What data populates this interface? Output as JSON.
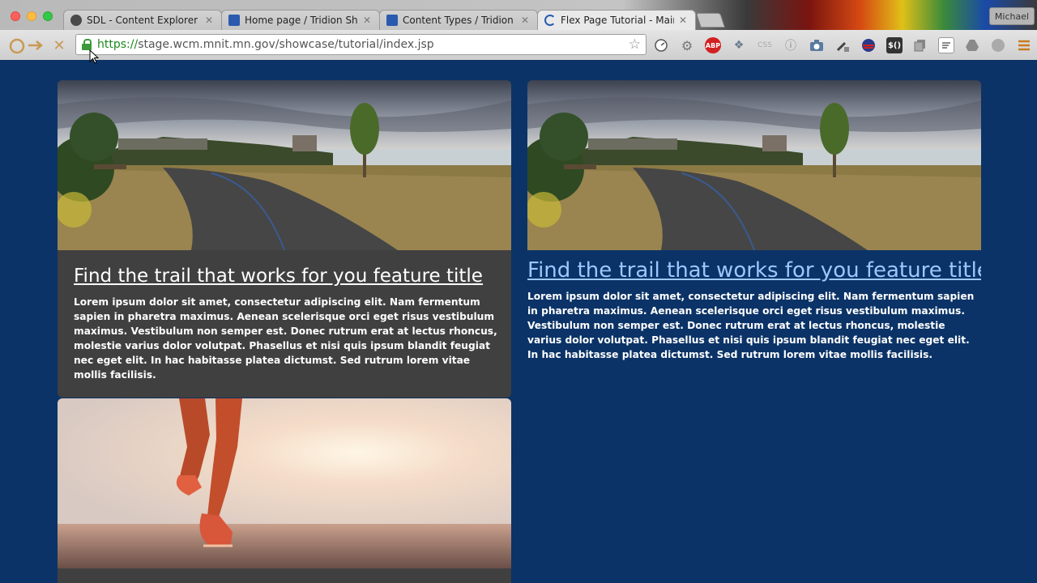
{
  "browser": {
    "tabs": [
      {
        "label": "SDL - Content Explorer",
        "favicon_color": "#4a4a4a",
        "active": false
      },
      {
        "label": "Home page / Tridion Showcase",
        "favicon_color": "#2a5ab0",
        "active": false
      },
      {
        "label": "Content Types / Tridion Showcase",
        "favicon_color": "#2a5ab0",
        "active": false
      },
      {
        "label": "Flex Page Tutorial - Main / Tridion",
        "favicon_color": "#2a5ab0",
        "active": true
      }
    ],
    "profile_name": "Michael",
    "url_scheme": "https://",
    "url_rest": "stage.wcm.mnit.mn.gov/showcase/tutorial/index.jsp",
    "extensions": [
      "ABP",
      "CSS",
      "$()"
    ]
  },
  "page": {
    "background": "#0b3367",
    "cards": [
      {
        "image": "lakeside-trail",
        "title": "Find the trail that works for you feature title",
        "body": "Lorem ipsum dolor sit amet, consectetur adipiscing elit. Nam fermentum sapien in pharetra maximus. Aenean scelerisque orci eget risus vestibulum maximus. Vestibulum non semper est. Donec rutrum erat at lectus rhoncus, molestie varius dolor volutpat. Phasellus et nisi quis ipsum blandit feugiat nec eget elit. In hac habitasse platea dictumst. Sed rutrum lorem vitae mollis facilisis.",
        "panel_color": "#404040",
        "title_color": "#ffffff"
      },
      {
        "image": "lakeside-trail",
        "title": "Find the trail that works for you feature title",
        "body": "Lorem ipsum dolor sit amet, consectetur adipiscing elit. Nam fermentum sapien in pharetra maximus. Aenean scelerisque orci eget risus vestibulum maximus. Vestibulum non semper est. Donec rutrum erat at lectus rhoncus, molestie varius dolor volutpat. Phasellus et nisi quis ipsum blandit feugiat nec eget elit. In hac habitasse platea dictumst. Sed rutrum lorem vitae mollis facilisis.",
        "panel_color": "#0b3367",
        "title_color": "#9cc8ff"
      },
      {
        "image": "runner-sunrise"
      }
    ]
  }
}
